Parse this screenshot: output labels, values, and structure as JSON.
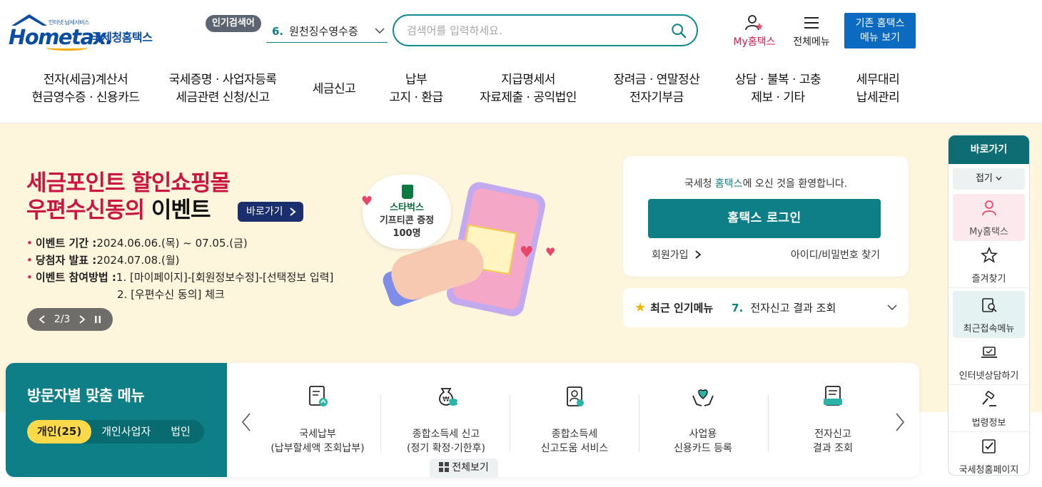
{
  "header": {
    "logo_small": "인터넷 납세서비스",
    "logo_brand": "Hometax.",
    "logo_kr": "국세청홈택스",
    "popular_tag": "인기검색어",
    "popular_num": "6.",
    "popular_keyword": "원천징수영수증",
    "search_placeholder": "검색어를 입력하세요.",
    "my_hometax": "My홈택스",
    "all_menu": "전체메뉴",
    "old_hometax_line1": "기존 홈택스",
    "old_hometax_line2": "메뉴 보기"
  },
  "gnb": [
    {
      "l1": "전자(세금)계산서",
      "l2": "현금영수증 · 신용카드"
    },
    {
      "l1": "국세증명 · 사업자등록",
      "l2": "세금관련 신청/신고"
    },
    {
      "l1": "세금신고",
      "l2": ""
    },
    {
      "l1": "납부",
      "l2": "고지 · 환급"
    },
    {
      "l1": "지급명세서",
      "l2": "자료제출 · 공익법인"
    },
    {
      "l1": "장려금 · 연말정산",
      "l2": "전자기부금"
    },
    {
      "l1": "상담 · 불복 · 고충",
      "l2": "제보 · 기타"
    },
    {
      "l1": "세무대리",
      "l2": "납세관리"
    }
  ],
  "event": {
    "title1": "세금포인트 할인쇼핑몰",
    "title2_red": "우편수신동의",
    "title2_black": " 이벤트",
    "go_label": "바로가기",
    "period_label": "이벤트 기간 : ",
    "period_value": "2024.06.06.(목) ~ 07.05.(금)",
    "winner_label": "당첨자 발표 : ",
    "winner_value": "2024.07.08.(월)",
    "method_label": "이벤트 참여방법 : ",
    "method_step1": "1. [마이페이지]-[회원정보수정]-[선택정보 입력]",
    "method_step2": "2. [우편수신 동의] 체크",
    "pager": "2/3",
    "bubble_line1": "스타벅스",
    "bubble_line2": "기프티콘 증정",
    "bubble_line3": "100명"
  },
  "login": {
    "welcome_pre": "국세청 ",
    "welcome_teal": "홈택스",
    "welcome_post": "에 오신 것을 환영합니다.",
    "login_button": "홈택스 로그인",
    "join": "회원가입",
    "find": "아이디/비밀번호 찾기"
  },
  "recent": {
    "title": "최근 인기메뉴",
    "num": "7.",
    "item": "전자신고 결과 조회"
  },
  "visitor": {
    "title": "방문자별 맞춤 메뉴",
    "tabs": [
      "개인(25)",
      "개인사업자",
      "법인"
    ],
    "items": [
      {
        "l1": "국세납부",
        "l2": "(납부할세액 조회납부)"
      },
      {
        "l1": "종합소득세 신고",
        "l2": "(정기 확정·기한후)"
      },
      {
        "l1": "종합소득세",
        "l2": "신고도움 서비스"
      },
      {
        "l1": "사업용",
        "l2": "신용카드 등록"
      },
      {
        "l1": "전자신고",
        "l2": "결과 조회"
      }
    ],
    "all_view": "전체보기"
  },
  "quick": {
    "title": "바로가기",
    "fold": "접기",
    "items": [
      "My홈택스",
      "즐겨찾기",
      "최근접속메뉴",
      "인터넷상담하기",
      "법령정보",
      "국세청홈페이지"
    ]
  },
  "colors": {
    "teal": "#0e7f86",
    "brand_blue": "#0b4da2",
    "event_red": "#c9153f",
    "banner_bg": "#fdf5dc"
  }
}
